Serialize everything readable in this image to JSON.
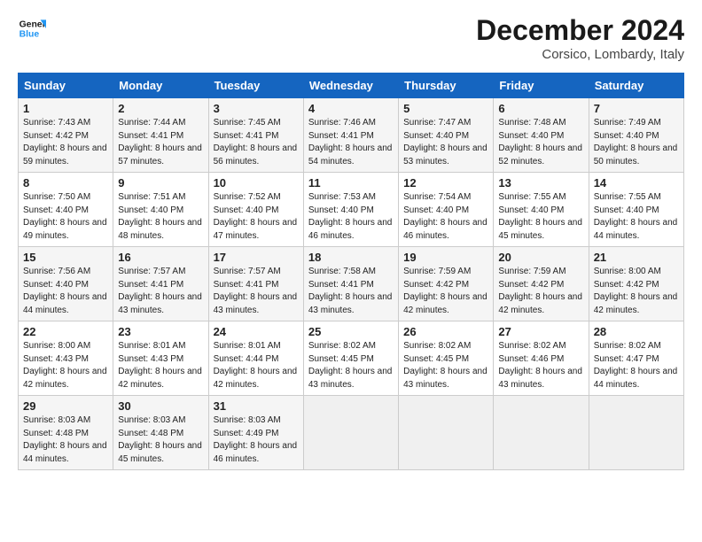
{
  "header": {
    "logo_line1": "General",
    "logo_line2": "Blue",
    "month": "December 2024",
    "location": "Corsico, Lombardy, Italy"
  },
  "weekdays": [
    "Sunday",
    "Monday",
    "Tuesday",
    "Wednesday",
    "Thursday",
    "Friday",
    "Saturday"
  ],
  "weeks": [
    [
      {
        "day": "1",
        "sunrise": "7:43 AM",
        "sunset": "4:42 PM",
        "daylight": "8 hours and 59 minutes."
      },
      {
        "day": "2",
        "sunrise": "7:44 AM",
        "sunset": "4:41 PM",
        "daylight": "8 hours and 57 minutes."
      },
      {
        "day": "3",
        "sunrise": "7:45 AM",
        "sunset": "4:41 PM",
        "daylight": "8 hours and 56 minutes."
      },
      {
        "day": "4",
        "sunrise": "7:46 AM",
        "sunset": "4:41 PM",
        "daylight": "8 hours and 54 minutes."
      },
      {
        "day": "5",
        "sunrise": "7:47 AM",
        "sunset": "4:40 PM",
        "daylight": "8 hours and 53 minutes."
      },
      {
        "day": "6",
        "sunrise": "7:48 AM",
        "sunset": "4:40 PM",
        "daylight": "8 hours and 52 minutes."
      },
      {
        "day": "7",
        "sunrise": "7:49 AM",
        "sunset": "4:40 PM",
        "daylight": "8 hours and 50 minutes."
      }
    ],
    [
      {
        "day": "8",
        "sunrise": "7:50 AM",
        "sunset": "4:40 PM",
        "daylight": "8 hours and 49 minutes."
      },
      {
        "day": "9",
        "sunrise": "7:51 AM",
        "sunset": "4:40 PM",
        "daylight": "8 hours and 48 minutes."
      },
      {
        "day": "10",
        "sunrise": "7:52 AM",
        "sunset": "4:40 PM",
        "daylight": "8 hours and 47 minutes."
      },
      {
        "day": "11",
        "sunrise": "7:53 AM",
        "sunset": "4:40 PM",
        "daylight": "8 hours and 46 minutes."
      },
      {
        "day": "12",
        "sunrise": "7:54 AM",
        "sunset": "4:40 PM",
        "daylight": "8 hours and 46 minutes."
      },
      {
        "day": "13",
        "sunrise": "7:55 AM",
        "sunset": "4:40 PM",
        "daylight": "8 hours and 45 minutes."
      },
      {
        "day": "14",
        "sunrise": "7:55 AM",
        "sunset": "4:40 PM",
        "daylight": "8 hours and 44 minutes."
      }
    ],
    [
      {
        "day": "15",
        "sunrise": "7:56 AM",
        "sunset": "4:40 PM",
        "daylight": "8 hours and 44 minutes."
      },
      {
        "day": "16",
        "sunrise": "7:57 AM",
        "sunset": "4:41 PM",
        "daylight": "8 hours and 43 minutes."
      },
      {
        "day": "17",
        "sunrise": "7:57 AM",
        "sunset": "4:41 PM",
        "daylight": "8 hours and 43 minutes."
      },
      {
        "day": "18",
        "sunrise": "7:58 AM",
        "sunset": "4:41 PM",
        "daylight": "8 hours and 43 minutes."
      },
      {
        "day": "19",
        "sunrise": "7:59 AM",
        "sunset": "4:42 PM",
        "daylight": "8 hours and 42 minutes."
      },
      {
        "day": "20",
        "sunrise": "7:59 AM",
        "sunset": "4:42 PM",
        "daylight": "8 hours and 42 minutes."
      },
      {
        "day": "21",
        "sunrise": "8:00 AM",
        "sunset": "4:42 PM",
        "daylight": "8 hours and 42 minutes."
      }
    ],
    [
      {
        "day": "22",
        "sunrise": "8:00 AM",
        "sunset": "4:43 PM",
        "daylight": "8 hours and 42 minutes."
      },
      {
        "day": "23",
        "sunrise": "8:01 AM",
        "sunset": "4:43 PM",
        "daylight": "8 hours and 42 minutes."
      },
      {
        "day": "24",
        "sunrise": "8:01 AM",
        "sunset": "4:44 PM",
        "daylight": "8 hours and 42 minutes."
      },
      {
        "day": "25",
        "sunrise": "8:02 AM",
        "sunset": "4:45 PM",
        "daylight": "8 hours and 43 minutes."
      },
      {
        "day": "26",
        "sunrise": "8:02 AM",
        "sunset": "4:45 PM",
        "daylight": "8 hours and 43 minutes."
      },
      {
        "day": "27",
        "sunrise": "8:02 AM",
        "sunset": "4:46 PM",
        "daylight": "8 hours and 43 minutes."
      },
      {
        "day": "28",
        "sunrise": "8:02 AM",
        "sunset": "4:47 PM",
        "daylight": "8 hours and 44 minutes."
      }
    ],
    [
      {
        "day": "29",
        "sunrise": "8:03 AM",
        "sunset": "4:48 PM",
        "daylight": "8 hours and 44 minutes."
      },
      {
        "day": "30",
        "sunrise": "8:03 AM",
        "sunset": "4:48 PM",
        "daylight": "8 hours and 45 minutes."
      },
      {
        "day": "31",
        "sunrise": "8:03 AM",
        "sunset": "4:49 PM",
        "daylight": "8 hours and 46 minutes."
      },
      null,
      null,
      null,
      null
    ]
  ]
}
